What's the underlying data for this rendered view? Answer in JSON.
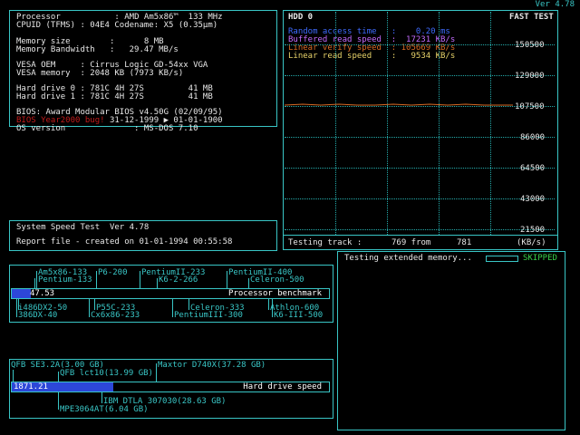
{
  "version": "Ver 4.78",
  "system_info": {
    "lines": [
      {
        "label": "Processor",
        "value": ": AMD Am5x86™  133 MHz"
      },
      {
        "label": "CPUID (TFMS)",
        "value": ": 04E4 Codename: X5 (0.35µm)"
      },
      {
        "label": "",
        "value": ""
      },
      {
        "label": "Memory size",
        "value": "        :      8 MB"
      },
      {
        "label": "Memory Bandwidth",
        "value": "   :   29.47 MB/s"
      },
      {
        "label": "",
        "value": ""
      },
      {
        "label": "VESA OEM",
        "value": ": Cirrus Logic GD-54xx VGA"
      },
      {
        "label": "VESA memory",
        "value": ": 2048 KB (7973 KB/s)"
      },
      {
        "label": "",
        "value": ""
      },
      {
        "label": "Hard drive 0",
        "value": ": 781C 4H 27S         41 MB"
      },
      {
        "label": "Hard drive 1",
        "value": ": 781C 4H 27S         41 MB"
      },
      {
        "label": "",
        "value": ""
      },
      {
        "label": "BIOS",
        "value": ": Award Modular BIOS v4.50G (02/09/95)"
      }
    ],
    "bios_date_warning": "BIOS Year2000 bug!",
    "bios_date_line": " 31-12-1999 ▶ 01-01-1900",
    "os_label": "OS version",
    "os_value": "              : MS-DOS 7.10"
  },
  "speed_test": {
    "title": "System Speed Test  Ver 4.78",
    "report": "Report file - created on 01-01-1994 00:55:58"
  },
  "hdd_panel": {
    "drive_label": "HDD 0",
    "mode": "FAST TEST",
    "legend": [
      {
        "name": "Random access time",
        "value": ":    0.20 ms",
        "color": "#3f6bff"
      },
      {
        "name": "Buffered read speed",
        "value": ":  17231 KB/s",
        "color": "#c56cff"
      },
      {
        "name": "Linear verify speed",
        "value": ": 105669 KB/s",
        "color": "#d86a24"
      },
      {
        "name": "Linear read speed",
        "value": ":   9534 KB/s",
        "color": "#e8d36a"
      }
    ],
    "y_ticks": [
      "150500",
      "129000",
      "107500",
      "86000",
      "64500",
      "43000",
      "21500"
    ],
    "status_left": "Testing track :",
    "status_mid": "769 from",
    "status_total": "781",
    "status_unit": "(KB/s)"
  },
  "memory_test": {
    "text": "Testing extended memory...",
    "status": "SKIPPED"
  },
  "cpu_benchmark": {
    "score": "47.53",
    "label": "Processor benchmark",
    "fill_fraction": 0.06,
    "top_labels": [
      {
        "text": "Am5x86-133",
        "left": 0
      },
      {
        "text": "P6-200",
        "left": 1
      },
      {
        "text": "PentiumII-233",
        "left": 2
      },
      {
        "text": "PentiumII-400",
        "left": 3
      },
      {
        "text": "Pentium-133",
        "left": 4
      },
      {
        "text": "K6-2-266",
        "left": 5
      },
      {
        "text": "Celeron-500",
        "left": 6
      }
    ],
    "bottom_labels": [
      {
        "text": "i486DX2-50",
        "left": 0
      },
      {
        "text": "P55C-233",
        "left": 1
      },
      {
        "text": "Celeron-333",
        "left": 2
      },
      {
        "text": "Athlon-600",
        "left": 3
      },
      {
        "text": "386DX-40",
        "left": 4
      },
      {
        "text": "Cx6x86-233",
        "left": 5
      },
      {
        "text": "PentiumIII-300",
        "left": 6
      },
      {
        "text": "K6-III-500",
        "left": 7
      }
    ]
  },
  "hdd_benchmark": {
    "score": "1871.21",
    "label": "Hard drive speed",
    "fill_fraction": 0.32,
    "top_labels": [
      {
        "text": "QFB SE3.2A(3.00 GB)",
        "left": 0
      },
      {
        "text": "Maxtor D740X(37.28 GB)",
        "left": 1
      },
      {
        "text": "QFB lct10(13.99 GB)",
        "left": 2
      }
    ],
    "bottom_labels": [
      {
        "text": "IBM DTLA 307030(28.63 GB)",
        "left": 0
      },
      {
        "text": "MPE3064AT(6.04 GB)",
        "left": 1
      }
    ]
  }
}
